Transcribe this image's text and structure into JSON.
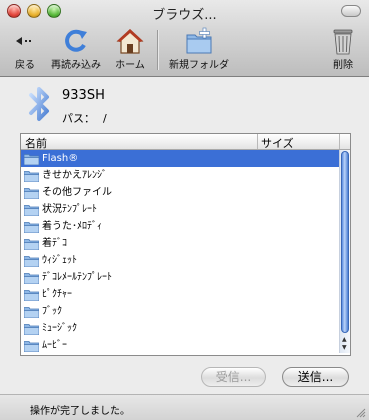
{
  "window": {
    "title": "ブラウズ..."
  },
  "toolbar": {
    "back": "戻る",
    "reload": "再読み込み",
    "home": "ホーム",
    "new_folder": "新規フォルダ",
    "delete": "削除"
  },
  "device": {
    "name": "933SH",
    "path_label": "パス：",
    "path_value": "/"
  },
  "list": {
    "columns": [
      "名前",
      "サイズ"
    ],
    "items": [
      "Flash®",
      "きせかえｱﾚﾝｼﾞ",
      "その他ファイル",
      "状況ﾃﾝﾌﾟﾚｰﾄ",
      "着うた･ﾒﾛﾃﾞｨ",
      "着ﾃﾞｺ",
      "ｳｨｼﾞｪｯﾄ",
      "ﾃﾞｺﾚﾒｰﾙﾃﾝﾌﾟﾚｰﾄ",
      "ﾋﾟｸﾁｬｰ",
      "ﾌﾞｯｸ",
      "ﾐｭｰｼﾞｯｸ",
      "ﾑｰﾋﾞｰ"
    ],
    "selected_index": 0
  },
  "buttons": {
    "receive": "受信...",
    "send": "送信..."
  },
  "status": {
    "text": "操作が完了しました。"
  },
  "colors": {
    "selection": "#3b6fd6",
    "folder": "#8fb8e6"
  }
}
